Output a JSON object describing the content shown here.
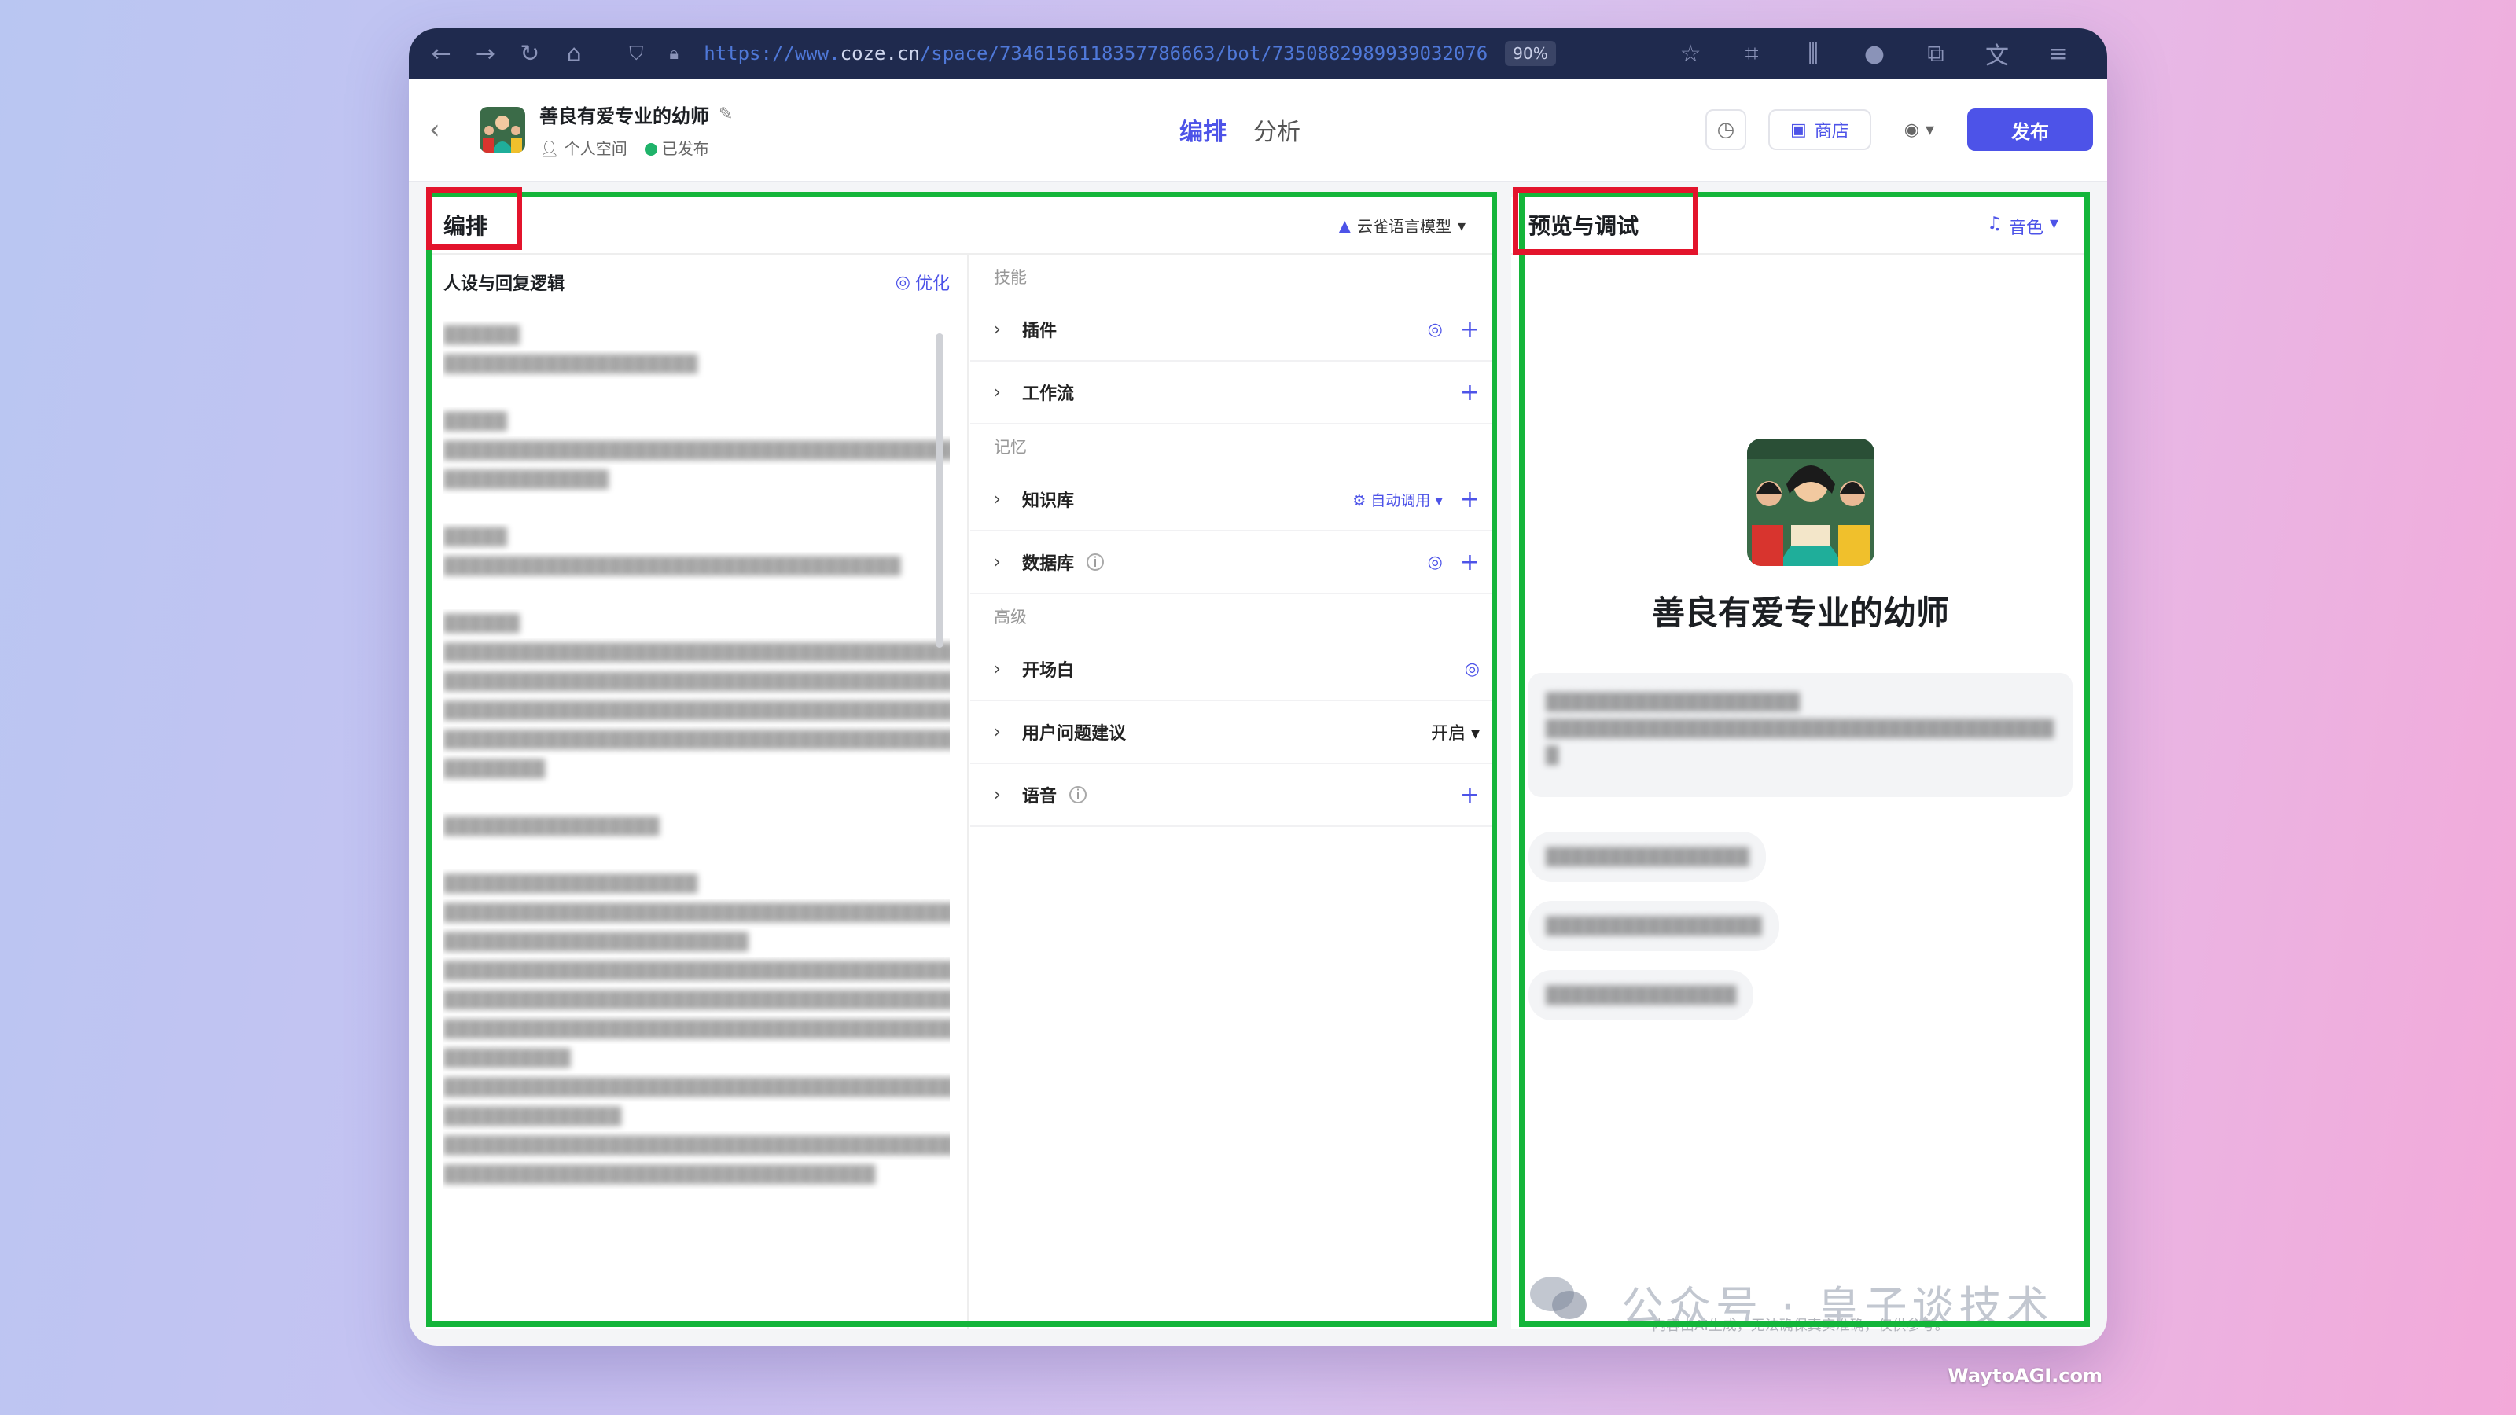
{
  "browser": {
    "url_prefix": "https://www.",
    "url_domain": "coze.cn",
    "url_path": "/space/7346156118357786663/bot/7350882989939032076",
    "zoom": "90%"
  },
  "header": {
    "bot_name": "善良有爱专业的幼师",
    "workspace": "个人空间",
    "status": "已发布",
    "tabs": {
      "arrange": "编排",
      "analyze": "分析"
    },
    "store_label": "商店",
    "publish_label": "发布"
  },
  "editor": {
    "title": "编排",
    "model": "云雀语言模型",
    "prompt_title": "人设与回复逻辑",
    "optimize_label": "优化"
  },
  "skills": {
    "section_skill": "技能",
    "plugin": "插件",
    "workflow": "工作流",
    "section_memory": "记忆",
    "knowledge": "知识库",
    "knowledge_mode": "自动调用",
    "database": "数据库",
    "section_advanced": "高级",
    "opening": "开场白",
    "suggestion": "用户问题建议",
    "suggestion_value": "开启",
    "voice": "语音"
  },
  "preview": {
    "title": "预览与调试",
    "voice_label": "音色",
    "bot_name": "善良有爱专业的幼师",
    "watermark": "公众号 · 皇子谈技术",
    "footer_note": "内容由AI生成，无法确保真实准确，仅供参考。"
  },
  "credit": "WaytoAGI.com"
}
